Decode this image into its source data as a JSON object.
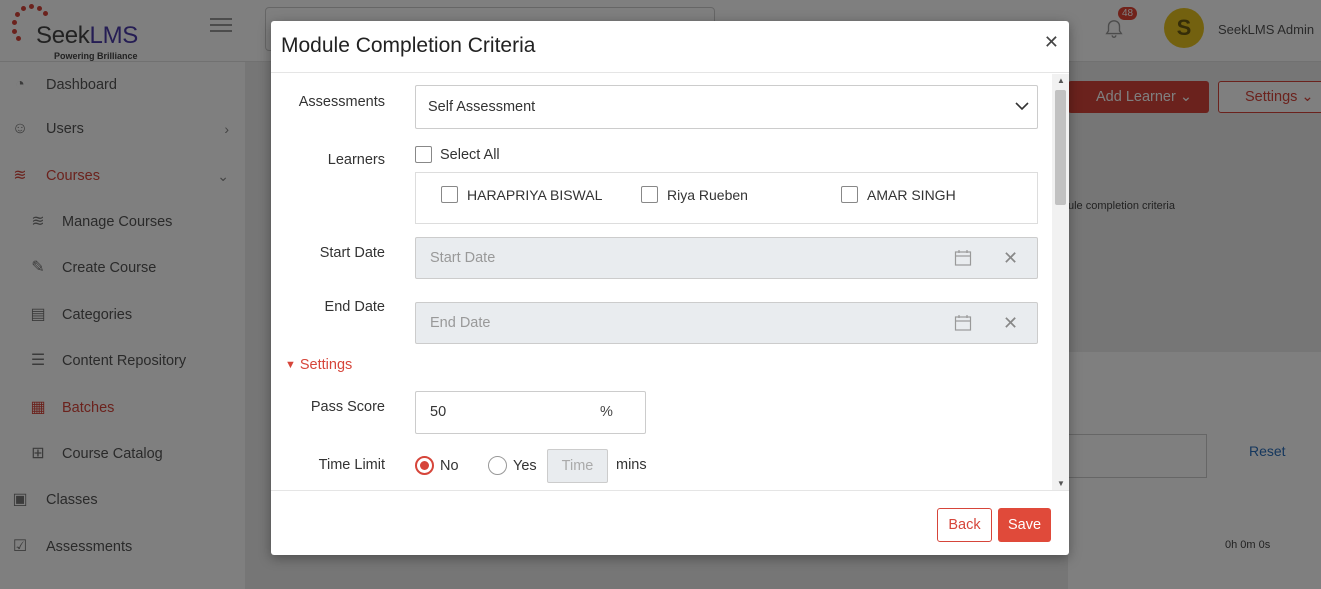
{
  "app": {
    "logo_text": "Seek",
    "logo_text_accent": "LMS",
    "logo_tagline": "Powering Brilliance",
    "notification_count": "48",
    "user_initial": "S",
    "user_name": "SeekLMS Admin"
  },
  "sidebar": {
    "items": [
      {
        "label": "Dashboard",
        "icon": "dashboard-icon"
      },
      {
        "label": "Users",
        "icon": "users-icon"
      },
      {
        "label": "Courses",
        "icon": "courses-icon"
      },
      {
        "label": "Manage Courses",
        "icon": "layers-icon"
      },
      {
        "label": "Create Course",
        "icon": "edit-icon"
      },
      {
        "label": "Categories",
        "icon": "categories-icon"
      },
      {
        "label": "Content Repository",
        "icon": "database-icon"
      },
      {
        "label": "Batches",
        "icon": "grid-icon"
      },
      {
        "label": "Course Catalog",
        "icon": "catalog-icon"
      },
      {
        "label": "Classes",
        "icon": "calendar-icon"
      },
      {
        "label": "Assessments",
        "icon": "checkbox-icon"
      }
    ]
  },
  "background": {
    "add_learner": "Add Learner",
    "settings": "Settings",
    "note": "ule completion criteria",
    "reset": "Reset",
    "time": "0h 0m 0s"
  },
  "modal": {
    "title": "Module Completion Criteria",
    "assessments_label": "Assessments",
    "assessment_selected": "Self Assessment",
    "learners_label": "Learners",
    "select_all_label": "Select All",
    "learners": [
      "HARAPRIYA BISWAL",
      "Riya Rueben",
      "AMAR SINGH"
    ],
    "start_date_label": "Start Date",
    "start_date_placeholder": "Start Date",
    "end_date_label": "End Date",
    "end_date_placeholder": "End Date",
    "settings_label": "Settings",
    "pass_score_label": "Pass Score",
    "pass_score_value": "50",
    "pass_score_unit": "%",
    "time_limit_label": "Time Limit",
    "time_limit_no": "No",
    "time_limit_yes": "Yes",
    "time_placeholder": "Time",
    "time_unit": "mins",
    "back_label": "Back",
    "save_label": "Save"
  },
  "colors": {
    "accent": "#d6453a",
    "link": "#2a6ebb"
  }
}
